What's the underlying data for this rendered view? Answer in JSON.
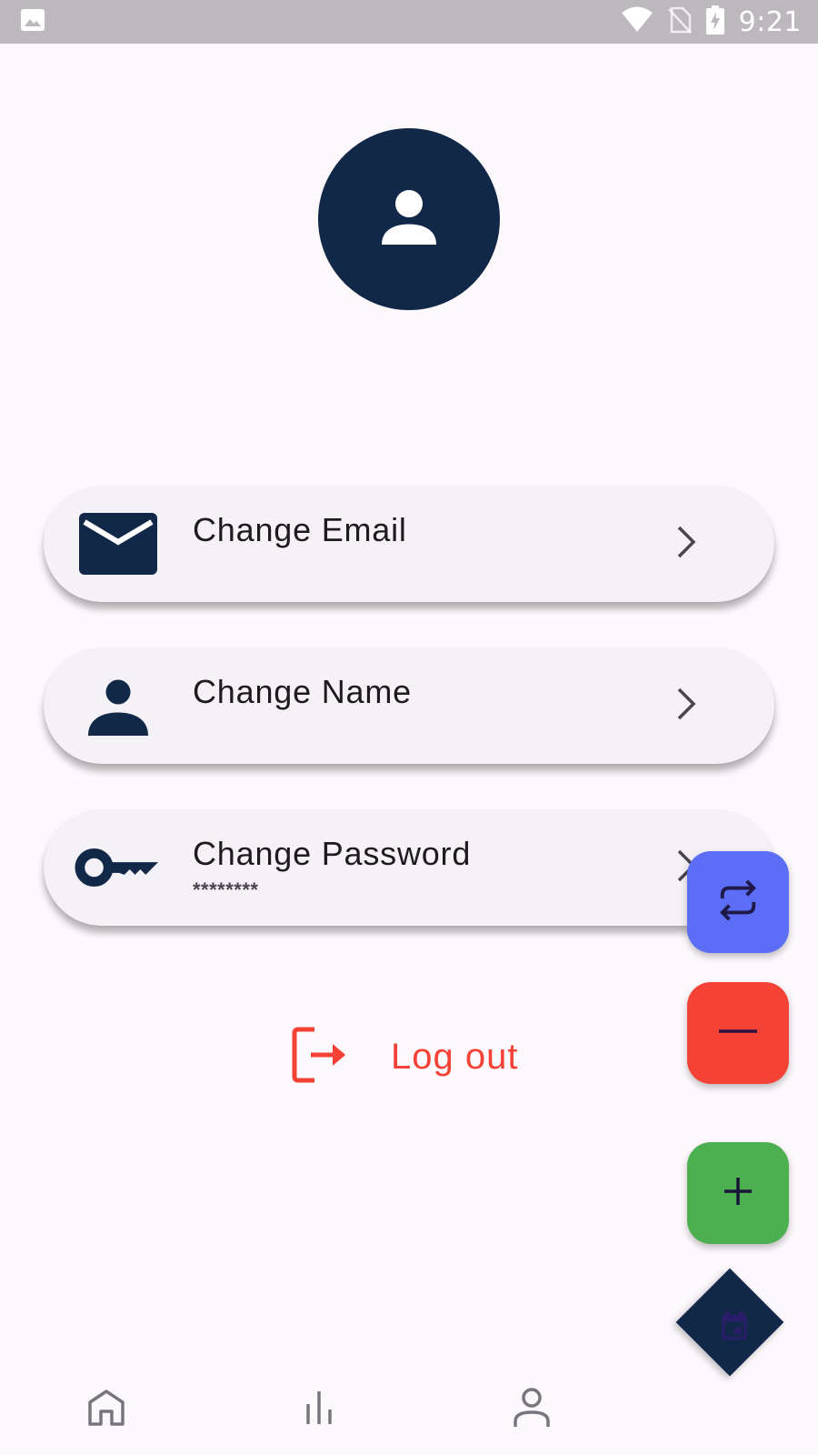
{
  "status_bar": {
    "time": "9:21",
    "icons": [
      "image-icon",
      "wifi-icon",
      "no-sim-icon",
      "battery-charging-icon"
    ]
  },
  "profile": {
    "avatar_icon": "person-icon"
  },
  "settings": [
    {
      "title": "Change Email",
      "subtitle": "",
      "icon": "email-icon"
    },
    {
      "title": "Change Name",
      "subtitle": "",
      "icon": "person-icon"
    },
    {
      "title": "Change Password",
      "subtitle": "********",
      "icon": "key-icon"
    }
  ],
  "logout": {
    "label": "Log out",
    "icon": "logout-icon"
  },
  "fabs": [
    {
      "icon": "swap-icon",
      "color": "#5B6EF5"
    },
    {
      "icon": "minus-icon",
      "color": "#F44336"
    },
    {
      "icon": "plus-icon",
      "color": "#4CAF50"
    },
    {
      "icon": "calendar-icon",
      "color": "#112848"
    }
  ],
  "bottom_nav": {
    "items": [
      "home-icon",
      "bar-chart-icon",
      "profile-icon"
    ]
  },
  "colors": {
    "primary_dark": "#112848",
    "background": "#FDF8FC",
    "card": "#F4F1F7",
    "danger": "#F44336",
    "accent_blue": "#5B6EF5",
    "accent_green": "#4CAF50",
    "status_bar": "#BDB7BE"
  }
}
